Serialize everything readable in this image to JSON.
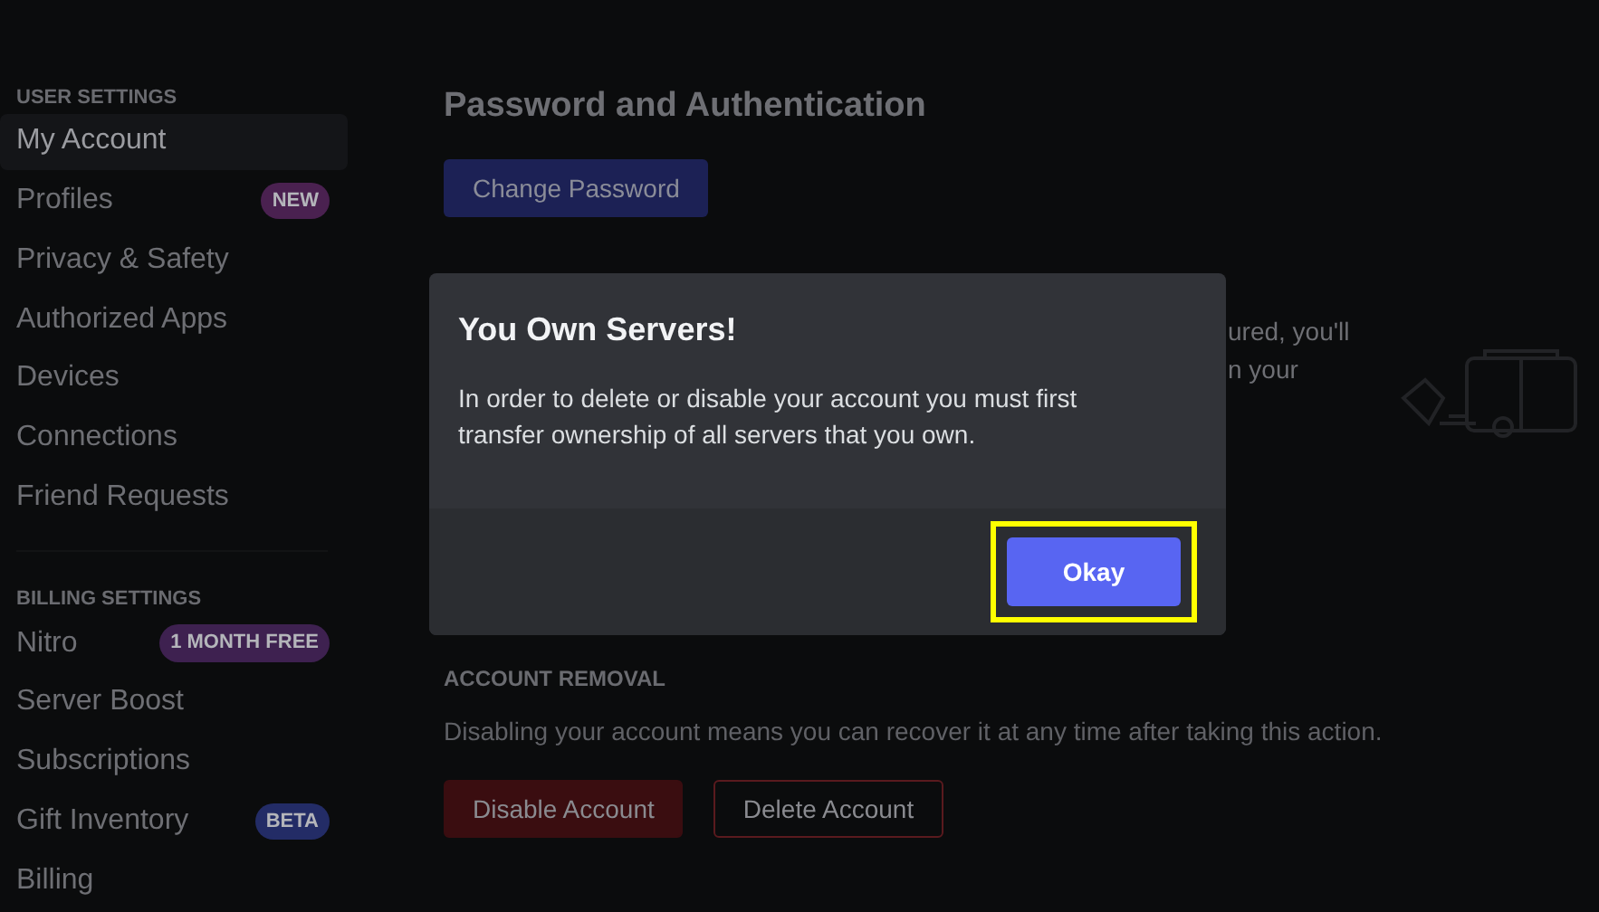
{
  "sidebar": {
    "sections": [
      {
        "header": "USER SETTINGS",
        "items": [
          {
            "label": "My Account",
            "selected": true
          },
          {
            "label": "Profiles",
            "selected": false,
            "badge": {
              "text": "NEW",
              "color": "#4a2150"
            }
          },
          {
            "label": "Privacy & Safety",
            "selected": false
          },
          {
            "label": "Authorized Apps",
            "selected": false
          },
          {
            "label": "Devices",
            "selected": false
          },
          {
            "label": "Connections",
            "selected": false
          },
          {
            "label": "Friend Requests",
            "selected": false
          }
        ]
      },
      {
        "header": "BILLING SETTINGS",
        "items": [
          {
            "label": "Nitro",
            "selected": false,
            "badge": {
              "text": "1 MONTH FREE",
              "color": "#3e2150"
            }
          },
          {
            "label": "Server Boost",
            "selected": false
          },
          {
            "label": "Subscriptions",
            "selected": false
          },
          {
            "label": "Gift Inventory",
            "selected": false,
            "badge": {
              "text": "BETA",
              "color": "#232c66"
            }
          },
          {
            "label": "Billing",
            "selected": false
          }
        ]
      }
    ]
  },
  "main": {
    "title": "Password and Authentication",
    "change_password_button": "Change Password",
    "partly_hidden_text": [
      "ured, you'll",
      "n your"
    ],
    "account_removal": {
      "header": "ACCOUNT REMOVAL",
      "description": "Disabling your account means you can recover it at any time after taking this action.",
      "buttons": [
        {
          "label": "Disable Account",
          "kind": "filled"
        },
        {
          "label": "Delete Account",
          "kind": "outline"
        }
      ]
    }
  },
  "modal": {
    "title": "You Own Servers!",
    "body": "In order to delete or disable your account you must first transfer ownership of all servers that you own.",
    "button": {
      "label": "Okay",
      "highlighted": true
    }
  }
}
